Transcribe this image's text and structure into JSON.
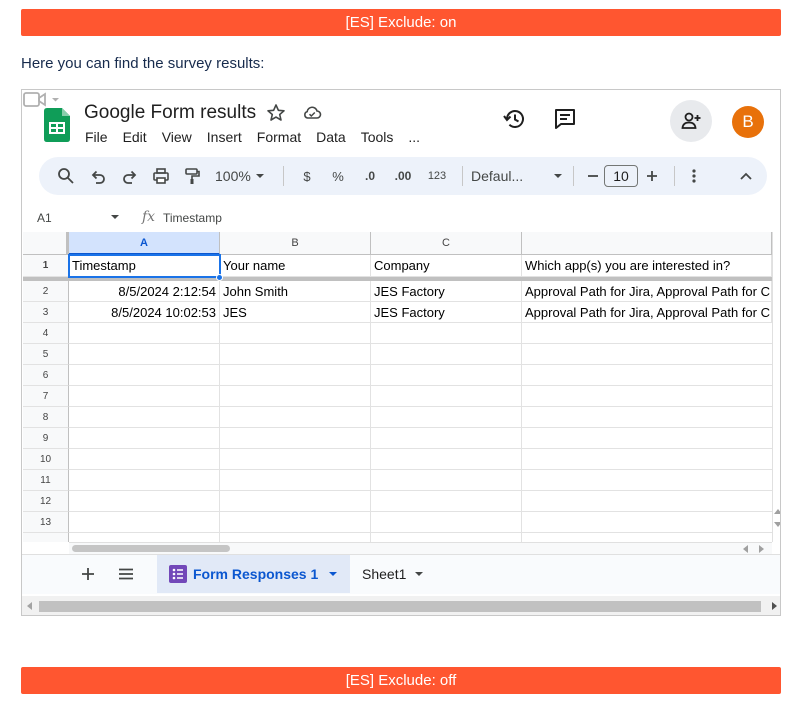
{
  "banners": {
    "top": "[ES] Exclude: on",
    "bottom": "[ES] Exclude: off"
  },
  "intro_text": "Here you can find the survey results:",
  "sheet": {
    "title": "Google Form results",
    "menu": [
      "File",
      "Edit",
      "View",
      "Insert",
      "Format",
      "Data",
      "Tools",
      "..."
    ],
    "avatar_letter": "B",
    "toolbar": {
      "zoom": "100%",
      "currency": "$",
      "percent": "%",
      "dec_less": ".0",
      "dec_more": ".00",
      "number_format": "123",
      "font": "Defaul...",
      "font_size": "10"
    },
    "formula_bar": {
      "cell_ref": "A1",
      "fx": "fx",
      "value": "Timestamp"
    },
    "columns": [
      "A",
      "B",
      "C",
      ""
    ],
    "row_numbers": [
      "1",
      "2",
      "3",
      "4",
      "5",
      "6",
      "7",
      "8",
      "9",
      "10",
      "11",
      "12",
      "13"
    ],
    "header_row": [
      "Timestamp",
      "Your name",
      "Company",
      "Which app(s) you are interested in?"
    ],
    "rows": [
      [
        "8/5/2024 2:12:54",
        "John Smith",
        "JES Factory",
        "Approval Path for Jira, Approval Path for C"
      ],
      [
        "8/5/2024 10:02:53",
        "JES",
        "JES Factory",
        "Approval Path for Jira, Approval Path for C"
      ]
    ],
    "tabs": [
      "Form Responses 1",
      "Sheet1"
    ]
  },
  "colors": {
    "banner": "#ff5630",
    "accent": "#0b57d0",
    "avatar": "#e8710a",
    "sheets_green": "#0f9d58"
  }
}
